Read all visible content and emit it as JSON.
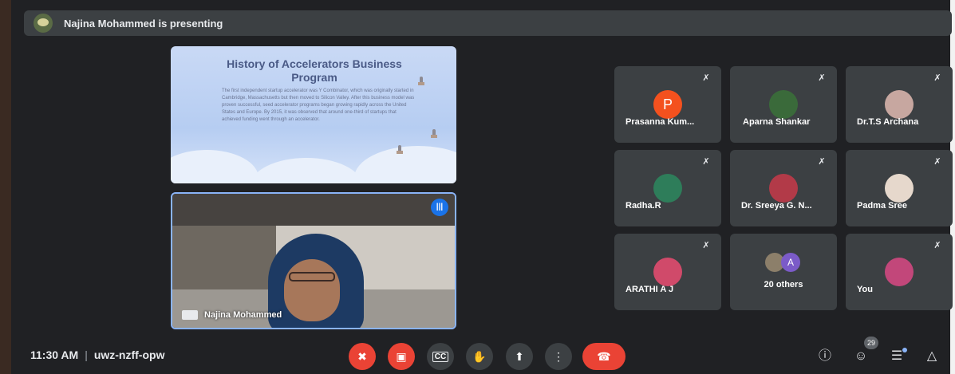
{
  "presenting_bar": {
    "text": "Najina Mohammed is presenting"
  },
  "slide": {
    "title": "History of Accelerators Business Program",
    "body": "The first independent startup accelerator was Y Combinator, which was originally started in Cambridge, Massachusetts but then moved to Silicon Valley. After this business model was proven successful, seed accelerator programs began growing rapidly across the United States and Europe. By 2015, it was observed that around one-third of startups that achieved funding went through an accelerator."
  },
  "presenter": {
    "name": "Najina Mohammed"
  },
  "participants": [
    {
      "name": "Prasanna Kum...",
      "avatar_letter": "P",
      "avatar_color": "#f4511e",
      "muted": true
    },
    {
      "name": "Aparna Shankar",
      "avatar_color": "#3a6a3a",
      "muted": true
    },
    {
      "name": "Dr.T.S Archana",
      "avatar_color": "#c7a7a0",
      "muted": true
    },
    {
      "name": "Radha.R",
      "avatar_color": "#2e7d5a",
      "muted": true
    },
    {
      "name": "Dr. Sreeya G. N...",
      "avatar_color": "#b23a48",
      "muted": true
    },
    {
      "name": "Padma Sree",
      "avatar_color": "#e6d8cc",
      "muted": true
    },
    {
      "name": "ARATHI A J",
      "avatar_color": "#d04a6a",
      "muted": true
    },
    {
      "name": "20 others",
      "avatar_letter": "A",
      "avatar_color": "#7b5bc8",
      "muted": false
    },
    {
      "name": "You",
      "avatar_color": "#c2477a",
      "muted": true
    }
  ],
  "meeting": {
    "time": "11:30 AM",
    "separator": "|",
    "code": "uwz-nzff-opw"
  },
  "controls": {
    "mic": "mic-off",
    "camera": "camera-off",
    "captions": "CC",
    "raise_hand": "raise-hand",
    "present": "present-screen",
    "more": "more-options",
    "end_call": "end-call"
  },
  "right_controls": {
    "people_count": "29"
  },
  "colors": {
    "accent": "#8ab4f8",
    "danger": "#ea4335",
    "surface": "#3c4043",
    "background": "#202124"
  }
}
